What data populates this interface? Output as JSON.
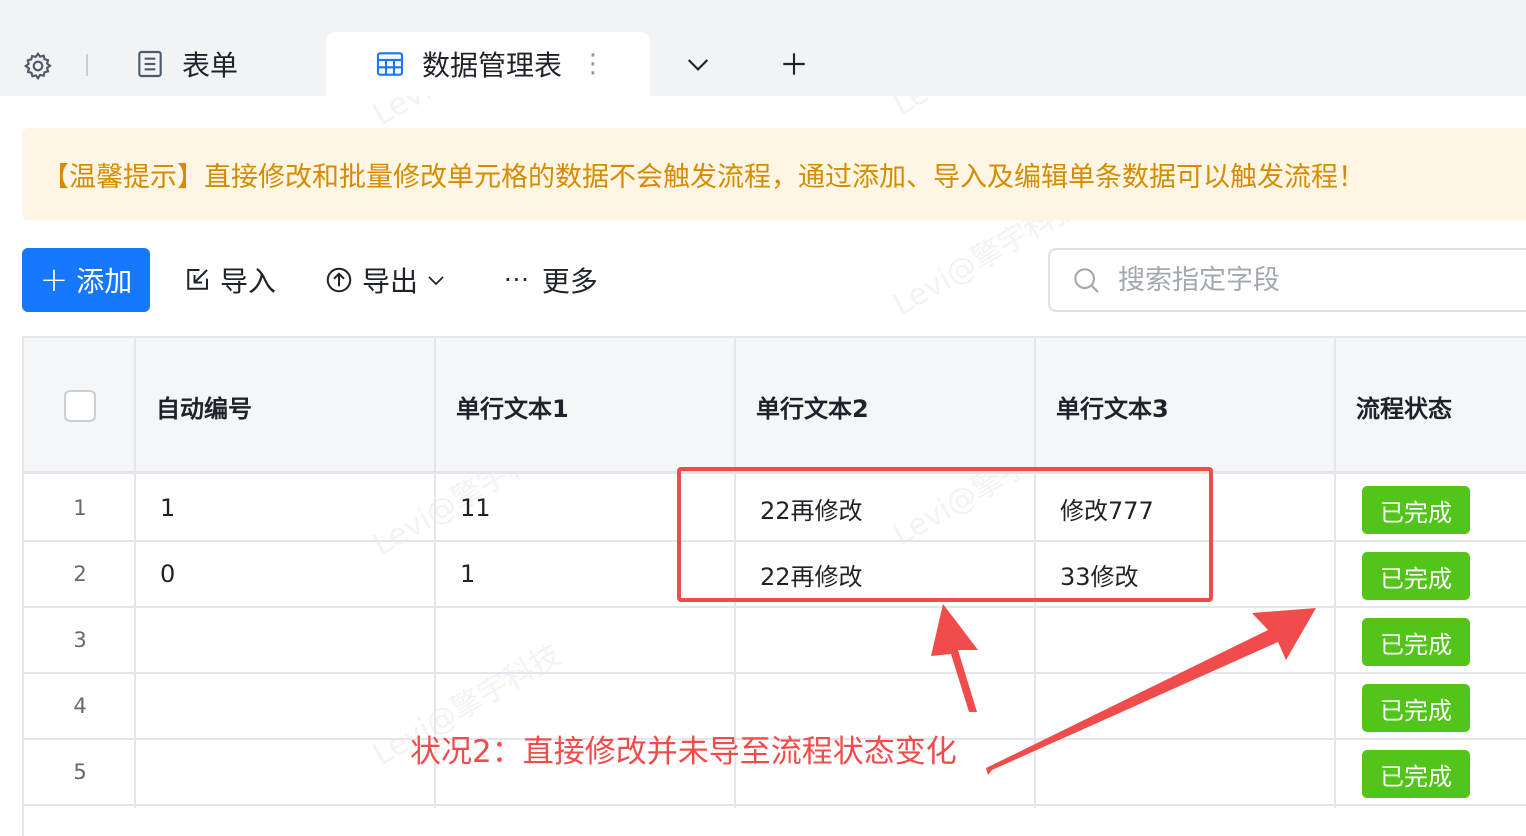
{
  "tabs": {
    "form_label": "表单",
    "active_label": "数据管理表",
    "active_more": "⋮"
  },
  "notice": "【温馨提示】直接修改和批量修改单元格的数据不会触发流程，通过添加、导入及编辑单条数据可以触发流程！",
  "toolbar": {
    "add_label": "添加",
    "import_label": "导入",
    "export_label": "导出",
    "more_label": "更多",
    "more_dots": "···"
  },
  "search": {
    "placeholder": "搜索指定字段"
  },
  "table": {
    "columns": [
      "自动编号",
      "单行文本1",
      "单行文本2",
      "单行文本3",
      "流程状态"
    ],
    "rows": [
      {
        "index": "1",
        "auto_no": "1",
        "text1": "11",
        "text2": "22再修改",
        "text3": "修改777",
        "status": "已完成"
      },
      {
        "index": "2",
        "auto_no": "0",
        "text1": "1",
        "text2": "22再修改",
        "text3": "33修改",
        "status": "已完成"
      },
      {
        "index": "3",
        "auto_no": "",
        "text1": "",
        "text2": "",
        "text3": "",
        "status": "已完成"
      },
      {
        "index": "4",
        "auto_no": "",
        "text1": "",
        "text2": "",
        "text3": "",
        "status": "已完成"
      },
      {
        "index": "5",
        "auto_no": "",
        "text1": "",
        "text2": "",
        "text3": "",
        "status": "已完成"
      }
    ]
  },
  "annotation": {
    "text": "状况2：直接修改并未导至流程状态变化",
    "color": "#f14c4c"
  },
  "watermark": "Levi@擎宇科技",
  "colors": {
    "primary": "#1677ff",
    "success": "#52c41a",
    "notice_text": "#d78b00",
    "notice_bg": "#fdf6e4"
  }
}
